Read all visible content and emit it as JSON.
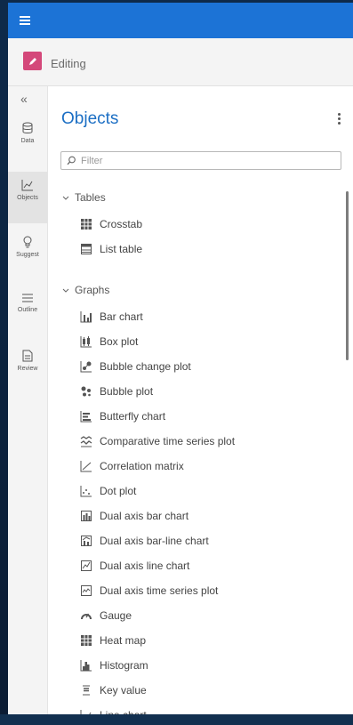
{
  "colors": {
    "topbar": "#1c73d6",
    "accent": "#1c6fc4",
    "edit_icon": "#d4487a"
  },
  "topbar": {
    "menu_icon": "hamburger-icon"
  },
  "editbar": {
    "label": "Editing",
    "icon": "pencil-icon"
  },
  "leftnav": {
    "collapse": "«",
    "items": [
      {
        "label": "Data",
        "icon": "database-icon"
      },
      {
        "label": "Objects",
        "icon": "chart-icon"
      },
      {
        "label": "Suggest",
        "icon": "lightbulb-icon"
      },
      {
        "label": "Outline",
        "icon": "list-icon"
      },
      {
        "label": "Review",
        "icon": "document-icon"
      }
    ]
  },
  "main": {
    "title": "Objects",
    "filter_placeholder": "Filter",
    "groups": [
      {
        "label": "Tables",
        "items": [
          "Crosstab",
          "List table"
        ]
      },
      {
        "label": "Graphs",
        "items": [
          "Bar chart",
          "Box plot",
          "Bubble change plot",
          "Bubble plot",
          "Butterfly chart",
          "Comparative time series plot",
          "Correlation matrix",
          "Dot plot",
          "Dual axis bar chart",
          "Dual axis bar-line chart",
          "Dual axis line chart",
          "Dual axis time series plot",
          "Gauge",
          "Heat map",
          "Histogram",
          "Key value",
          "Line chart"
        ]
      }
    ]
  }
}
